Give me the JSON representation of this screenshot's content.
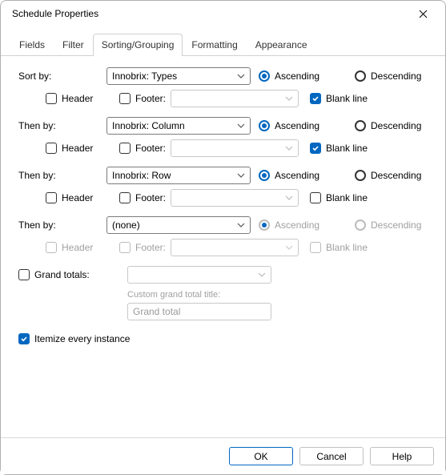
{
  "title": "Schedule Properties",
  "tabs": {
    "fields": "Fields",
    "filter": "Filter",
    "sortingGrouping": "Sorting/Grouping",
    "formatting": "Formatting",
    "appearance": "Appearance"
  },
  "labels": {
    "sortBy": "Sort by:",
    "thenBy": "Then by:",
    "header": "Header",
    "footer": "Footer:",
    "ascending": "Ascending",
    "descending": "Descending",
    "blankLine": "Blank line",
    "grandTotals": "Grand totals:",
    "customGrandTotalTitle": "Custom grand total title:",
    "itemize": "Itemize every instance"
  },
  "sort1": {
    "value": "Innobrix: Types",
    "header": false,
    "footer": false,
    "footerValue": "",
    "ascending": true,
    "blank": true,
    "enabled": true
  },
  "sort2": {
    "value": "Innobrix: Column",
    "header": false,
    "footer": false,
    "footerValue": "",
    "ascending": true,
    "blank": true,
    "enabled": true
  },
  "sort3": {
    "value": "Innobrix: Row",
    "header": false,
    "footer": false,
    "footerValue": "",
    "ascending": true,
    "blank": false,
    "enabled": true
  },
  "sort4": {
    "value": "(none)",
    "header": false,
    "footer": false,
    "footerValue": "",
    "ascending": true,
    "blank": false,
    "enabled": false
  },
  "grandTotals": {
    "checked": false,
    "selectValue": "",
    "inputValue": "Grand total"
  },
  "itemize": {
    "checked": true
  },
  "buttons": {
    "ok": "OK",
    "cancel": "Cancel",
    "help": "Help"
  }
}
